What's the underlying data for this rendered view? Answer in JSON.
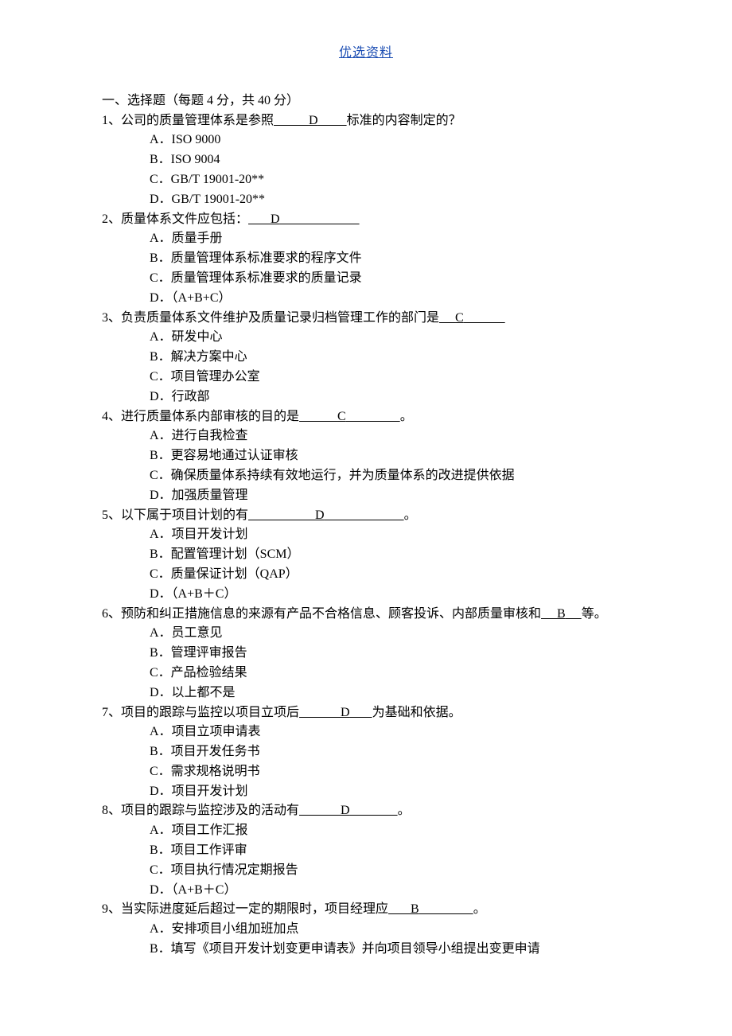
{
  "header": {
    "title": "优选资料"
  },
  "section": {
    "title": "一、选择题（每题 4 分，共 40 分）"
  },
  "q1": {
    "pre": "1、公司的质量管理体系是参照",
    "blank1": "           ",
    "ans": "D",
    "blank2": "         ",
    "post": "标准的内容制定的？",
    "a": "A．ISO 9000",
    "b": "B．ISO 9004",
    "c": "C．GB/T 19001-20**",
    "d": "D．GB/T 19001-20**"
  },
  "q2": {
    "pre": "2、质量体系文件应包括：",
    "blank1": "       ",
    "ans": "D",
    "blank2": "                         ",
    "a": "A．质量手册",
    "b": "B．质量管理体系标准要求的程序文件",
    "c": "C．质量管理体系标准要求的质量记录",
    "d": "D．（A+B+C）"
  },
  "q3": {
    "pre": "3、负责质量体系文件维护及质量记录归档管理工作的部门是",
    "blank1": "     ",
    "ans": "C",
    "blank2": "             ",
    "a": "A．研发中心",
    "b": "B．解决方案中心",
    "c": "C．项目管理办公室",
    "d": "D．行政部"
  },
  "q4": {
    "pre": "4、进行质量体系内部审核的目的是",
    "blank1": "            ",
    "ans": "C",
    "blank2": "                 ",
    "post": "。",
    "a": "A．进行自我检查",
    "b": "B．更容易地通过认证审核",
    "c": "C．确保质量体系持续有效地运行，并为质量体系的改进提供依据",
    "d": "D．加强质量管理"
  },
  "q5": {
    "pre": "5、以下属于项目计划的有",
    "blank1": "                     ",
    "ans": "D",
    "blank2": "                         ",
    "post": "。",
    "a": "A．项目开发计划",
    "b": "B．配置管理计划（SCM）",
    "c": "C．质量保证计划（QAP）",
    "d": "D．（A+B＋C）"
  },
  "q6": {
    "pre": "6、预防和纠正措施信息的来源有产品不合格信息、顾客投诉、内部质量审核和",
    "blank1": "     ",
    "ans": "B",
    "blank2": "     ",
    "post": "等。",
    "a": "A．员工意见",
    "b": "B．管理评审报告",
    "c": "C．产品检验结果",
    "d": "D．以上都不是"
  },
  "q7": {
    "pre": "7、项目的跟踪与监控以项目立项后",
    "blank1": "             ",
    "ans": "D",
    "blank2": "       ",
    "post": "为基础和依据。",
    "a": "A．项目立项申请表",
    "b": "B．项目开发任务书",
    "c": "C．需求规格说明书",
    "d": "D．项目开发计划"
  },
  "q8": {
    "pre": "8、项目的跟踪与监控涉及的活动有",
    "blank1": "             ",
    "ans": "D",
    "blank2": "               ",
    "post": "。",
    "a": "A．项目工作汇报",
    "b": "B．项目工作评审",
    "c": "C．项目执行情况定期报告",
    "d": "D．（A+B＋C）"
  },
  "q9": {
    "pre": "9、当实际进度延后超过一定的期限时，项目经理应",
    "blank1": "       ",
    "ans": "B",
    "blank2": "                 ",
    "post": "。",
    "a": "A．安排项目小组加班加点",
    "b": "B．填写《项目开发计划变更申请表》并向项目领导小组提出变更申请"
  }
}
